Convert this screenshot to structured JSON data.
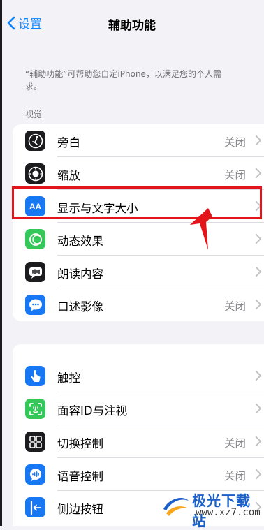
{
  "nav": {
    "back_label": "设置",
    "title": "辅助功能"
  },
  "description": "“辅助功能”可帮助您自定iPhone，以满足您的个人需求。",
  "section_vision": {
    "header": "视觉"
  },
  "vision_items": [
    {
      "label": "旁白",
      "value": "关闭",
      "icon": "voiceover-icon"
    },
    {
      "label": "缩放",
      "value": "关闭",
      "icon": "zoom-icon"
    },
    {
      "label": "显示与文字大小",
      "value": "",
      "icon": "display-text-size-icon"
    },
    {
      "label": "动态效果",
      "value": "",
      "icon": "motion-icon"
    },
    {
      "label": "朗读内容",
      "value": "",
      "icon": "spoken-content-icon"
    },
    {
      "label": "口述影像",
      "value": "关闭",
      "icon": "audio-descriptions-icon"
    }
  ],
  "physical_items": [
    {
      "label": "触控",
      "value": "",
      "icon": "touch-icon"
    },
    {
      "label": "面容ID与注视",
      "value": "",
      "icon": "face-id-icon"
    },
    {
      "label": "切换控制",
      "value": "关闭",
      "icon": "switch-control-icon"
    },
    {
      "label": "语音控制",
      "value": "关闭",
      "icon": "voice-control-icon"
    },
    {
      "label": "侧边按钮",
      "value": "",
      "icon": "side-button-icon"
    }
  ],
  "icon_glyphs": {
    "display_text_size": "AA"
  },
  "watermark": {
    "text": "极光下载站",
    "url": "www.xz7.com"
  },
  "colors": {
    "accent": "#0a84ff",
    "highlight": "#e4141b",
    "icon_dark": "#1c1c1e",
    "icon_blue": "#1877f2",
    "icon_green": "#34c759"
  }
}
